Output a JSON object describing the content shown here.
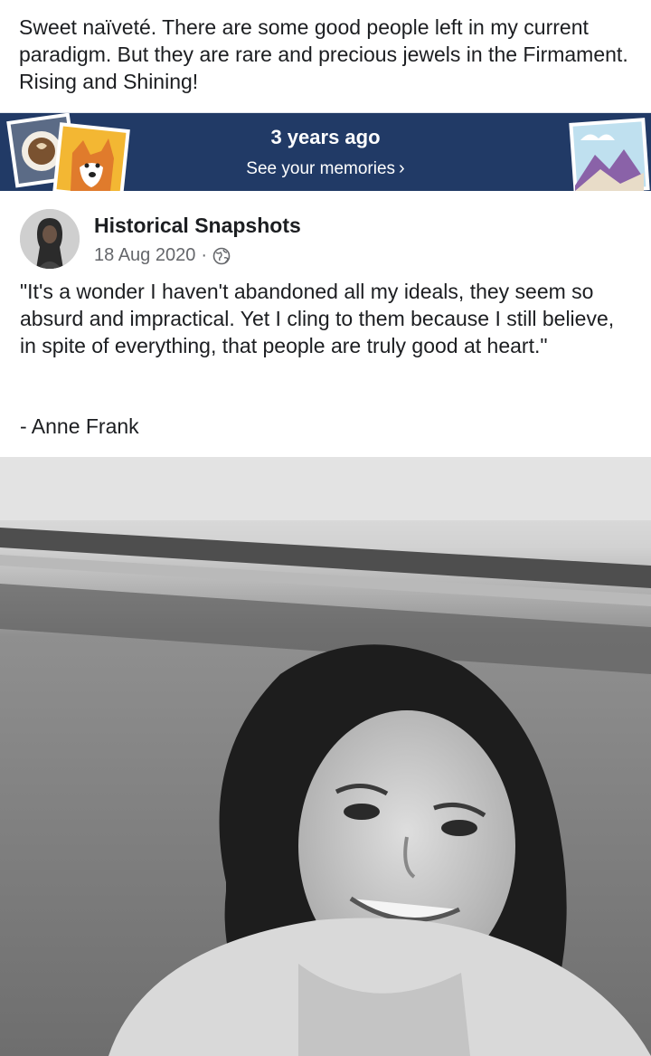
{
  "caption": "Sweet naïveté.  There are some good people left in my current paradigm.  But they are rare and precious jewels in the Firmament.  Rising and Shining!",
  "memories": {
    "title": "3 years ago",
    "link_label": "See your memories",
    "chevron": "›",
    "background": "#213a66"
  },
  "post": {
    "author": "Historical Snapshots",
    "date": "18 Aug 2020",
    "separator": "·",
    "privacy_icon": "globe-icon",
    "quote": "\"It's a wonder I haven't abandoned all my ideals, they seem so absurd and impractical. Yet I cling to them because I still believe, in spite of everything, that people are truly good at heart.\"",
    "attribution": "- Anne Frank"
  },
  "photo": {
    "subject": "black-and-white portrait photo"
  }
}
